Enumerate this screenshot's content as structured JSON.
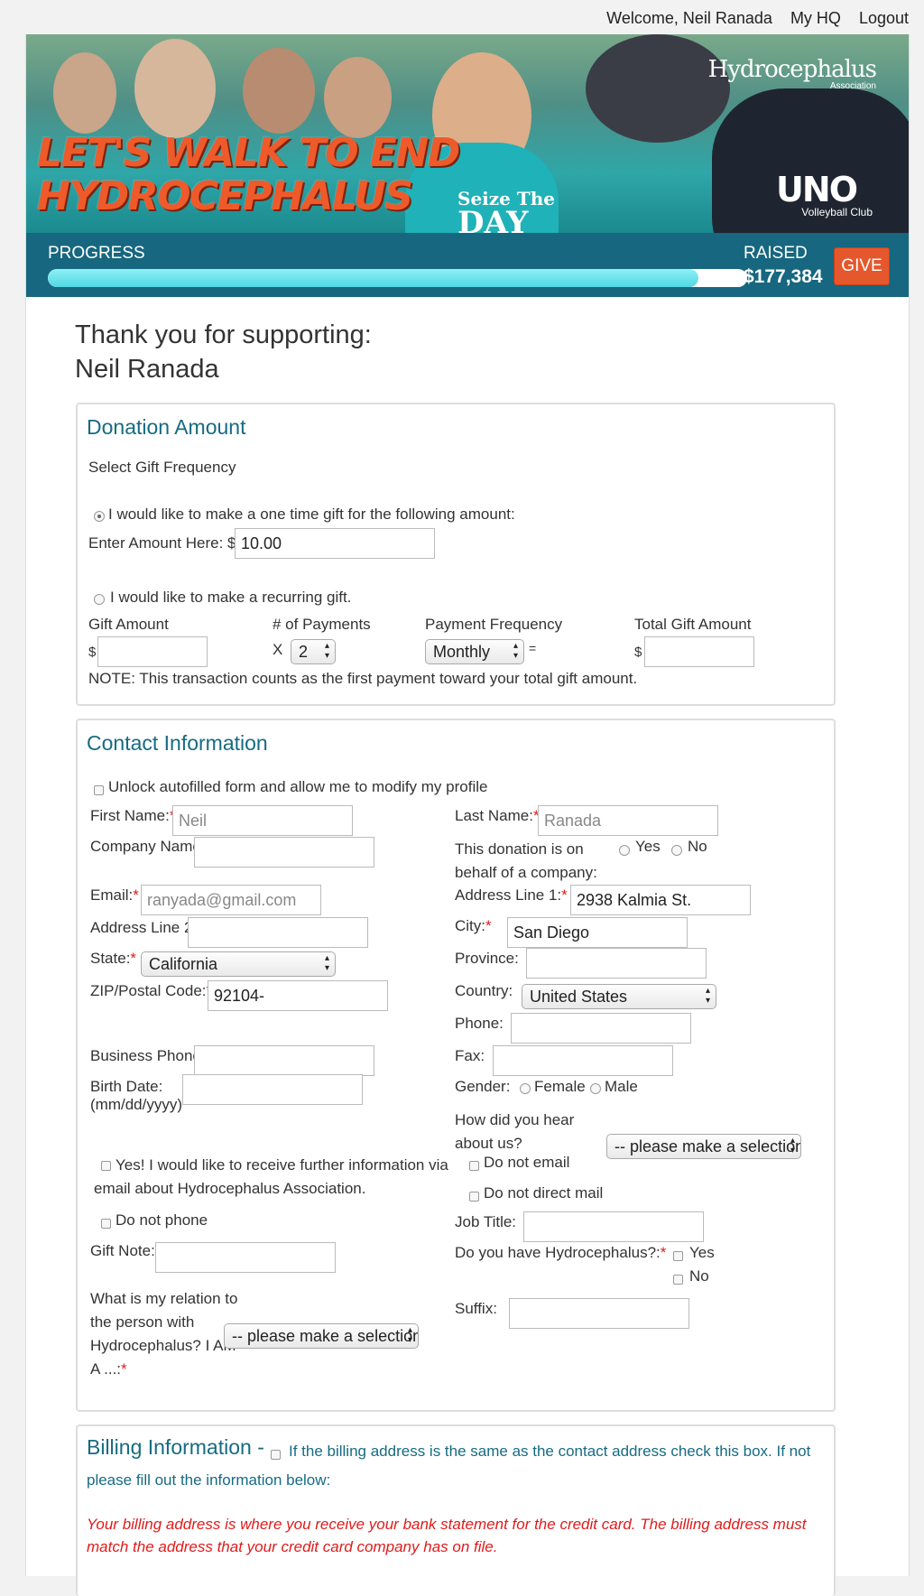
{
  "topnav": {
    "welcome": "Welcome, Neil Ranada",
    "my_hq": "My HQ",
    "logout": "Logout"
  },
  "banner": {
    "title_line1": "LET'S WALK TO END",
    "title_line2": "HYDROCEPHALUS",
    "shirt_line1": "Seize The",
    "shirt_line2": "DAY",
    "logo": "Hydrocephalus",
    "logo_sub": "Association",
    "sponsor": "UNO",
    "sponsor_sub": "Volleyball Club"
  },
  "progress": {
    "label": "PROGRESS",
    "fraction": 0.93,
    "raised_label": "RAISED",
    "raised_amount": "$177,384",
    "give": "GIVE"
  },
  "thanks": {
    "line1": "Thank you for supporting:",
    "line2": "Neil Ranada"
  },
  "donation": {
    "title": "Donation Amount",
    "frequency_label": "Select Gift Frequency",
    "one_time_label": "I would like to make a one time gift for the following amount:",
    "amount_label": "Enter Amount Here: $",
    "amount_value": "10.00",
    "recurring_label": "I would like to make a recurring gift.",
    "gift_amount_label": "Gift Amount",
    "payments_label": "# of Payments",
    "frequency_col_label": "Payment Frequency",
    "total_label": "Total Gift Amount",
    "dollar": "$",
    "times": "X",
    "equals": "=",
    "payments_value": "2",
    "frequency_value": "Monthly",
    "note": "NOTE: This transaction counts as the first payment toward your total gift amount."
  },
  "contact": {
    "title": "Contact Information",
    "unlock_label": "Unlock autofilled form and allow me to modify my profile",
    "first_name_label": "First Name:",
    "first_name_value": "Neil",
    "last_name_label": "Last Name:",
    "last_name_value": "Ranada",
    "company_label": "Company Name:",
    "behalf_label_1": "This donation is on",
    "behalf_label_2": "behalf of a company:",
    "yes": "Yes",
    "no": "No",
    "email_label": "Email:",
    "email_value": "ranyada@gmail.com",
    "address1_label": "Address Line 1:",
    "address1_value": "2938 Kalmia St.",
    "address2_label": "Address Line 2:",
    "city_label": "City:",
    "city_value": "San Diego",
    "state_label": "State:",
    "state_value": "California",
    "province_label": "Province:",
    "zip_label": "ZIP/Postal Code:",
    "zip_value": "92104-",
    "country_label": "Country:",
    "country_value": "United States",
    "phone_label": "Phone:",
    "business_phone_label": "Business Phone:",
    "fax_label": "Fax:",
    "birth_label_1": "Birth Date:",
    "birth_label_2": "(mm/dd/yyyy)",
    "gender_label": "Gender:",
    "female": "Female",
    "male": "Male",
    "hear_label_1": "How did you hear",
    "hear_label_2": "about us?",
    "hear_value": "-- please make a selection",
    "info_label_1": "Yes! I would like to receive further information via",
    "info_label_2": "email about Hydrocephalus Association.",
    "no_email": "Do not email",
    "no_mail": "Do not direct mail",
    "no_phone": "Do not phone",
    "job_label": "Job Title:",
    "gift_note_label": "Gift Note:",
    "have_hydro_label": "Do you have Hydrocephalus?:",
    "relation_label_1": "What is my relation to",
    "relation_label_2": "the person with",
    "relation_label_3": "Hydrocephalus? I AM",
    "relation_label_4": "A ...:",
    "relation_value": "-- please make a selection",
    "suffix_label": "Suffix:",
    "asterisk": "*"
  },
  "billing": {
    "title": "Billing Information -",
    "same_label_1": "If the billing address is the same as the contact address check this box. If not",
    "same_label_2": "please fill out the information below:",
    "note_1": "Your billing address is where you receive your bank statement for the credit card. The billing address must",
    "note_2": "match the address that your credit card company has on file."
  }
}
